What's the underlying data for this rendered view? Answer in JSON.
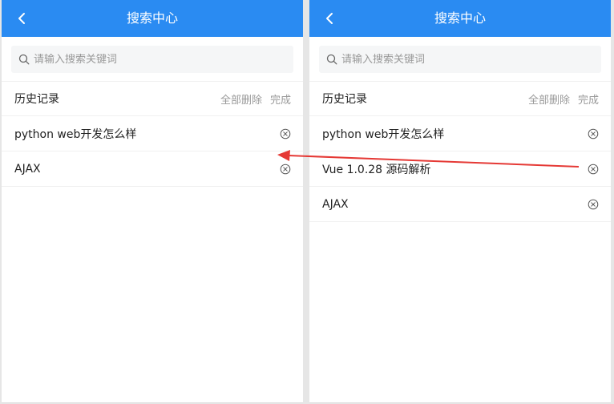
{
  "left_panel": {
    "header": {
      "title": "搜索中心"
    },
    "search": {
      "placeholder": "请输入搜索关键词"
    },
    "history": {
      "title": "历史记录",
      "delete_all_label": "全部删除",
      "done_label": "完成",
      "items": [
        {
          "label": "python web开发怎么样"
        },
        {
          "label": "AJAX"
        }
      ]
    }
  },
  "right_panel": {
    "header": {
      "title": "搜索中心"
    },
    "search": {
      "placeholder": "请输入搜索关键词"
    },
    "history": {
      "title": "历史记录",
      "delete_all_label": "全部删除",
      "done_label": "完成",
      "items": [
        {
          "label": "python web开发怎么样"
        },
        {
          "label": "Vue 1.0.28 源码解析"
        },
        {
          "label": "AJAX"
        }
      ]
    }
  },
  "colors": {
    "header_bg": "#2a8bf2",
    "annotation_arrow": "#e53935"
  },
  "icons": [
    "chevron-left-icon",
    "search-icon",
    "close-circle-icon"
  ]
}
